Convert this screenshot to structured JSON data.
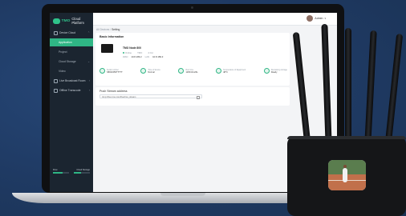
{
  "brand": {
    "logo_text": "TMO",
    "subtitle": "Cloud Platform"
  },
  "sidebar": {
    "items": [
      {
        "label": "Device Cloud"
      },
      {
        "label": "Application"
      },
      {
        "label": "Project"
      },
      {
        "label": "Cloud Storage"
      },
      {
        "label": "Video"
      },
      {
        "label": "Live Broadcast Room"
      },
      {
        "label": "Offline Transcode"
      }
    ],
    "storage": {
      "left_label": "Flow",
      "right_label": "Cloud Storage",
      "left_fill_percent": 60,
      "right_fill_percent": 45
    }
  },
  "header": {
    "user_name": "Admin"
  },
  "breadcrumb": {
    "parent": "All Devices",
    "current": "Setting"
  },
  "basic_info": {
    "title": "Basic Information",
    "device_name": "TMO Node 800",
    "status": "Online",
    "model": "TMO",
    "channels": "4 CH",
    "ip_label_1": "WAN",
    "ip_value_1": "10.8.189.2",
    "ip_label_2": "LAN",
    "ip_value_2": "10.8.189.3"
  },
  "stats": [
    {
      "label": "Serial number",
      "value": "S8023456TTTTT"
    },
    {
      "label": "Time of device",
      "value": "Normal"
    },
    {
      "label": "Run time",
      "value": "126h13m26s"
    },
    {
      "label": "Temperature of Equipment",
      "value": "48°C"
    },
    {
      "label": "Remaining storage",
      "value": "Ready"
    }
  ],
  "stream": {
    "title": "Push Stream address",
    "url": "rtmp://live.tmo.com/live/tmo_stream"
  }
}
